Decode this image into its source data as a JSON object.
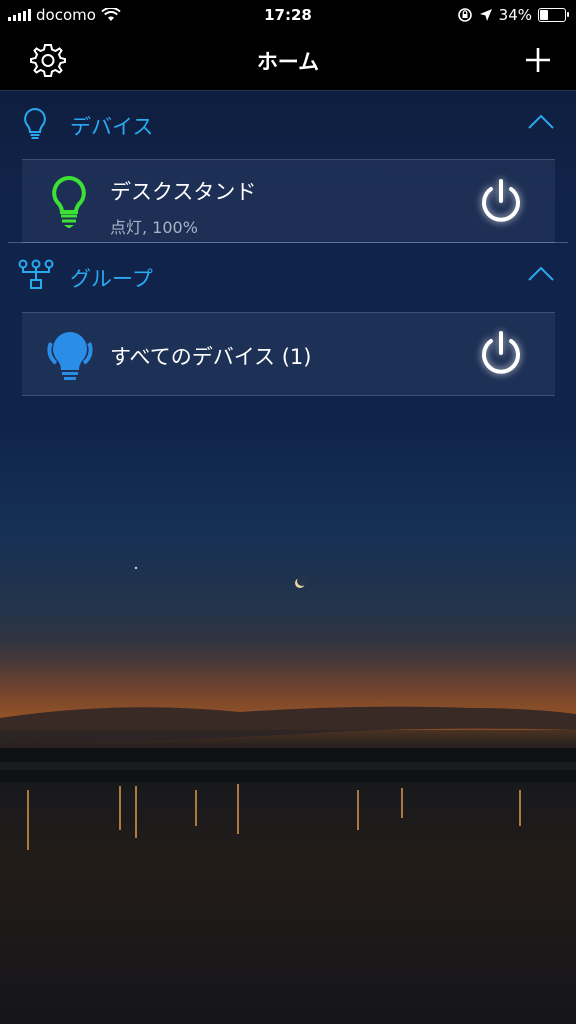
{
  "status_bar": {
    "carrier": "docomo",
    "time": "17:28",
    "battery_percent": "34%"
  },
  "nav": {
    "title": "ホーム",
    "settings_icon": "gear-icon",
    "add_icon": "plus-icon"
  },
  "sections": {
    "devices": {
      "label": "デバイス",
      "icon": "lightbulb-outline-icon",
      "items": [
        {
          "name": "デスクスタンド",
          "status": "点灯, 100%",
          "icon": "lightbulb-green-icon",
          "icon_color": "#3de034"
        }
      ]
    },
    "groups": {
      "label": "グループ",
      "icon": "group-tree-icon",
      "items": [
        {
          "name": "すべてのデバイス (1)",
          "icon": "lightbulb-blue-icon",
          "icon_color": "#2a8de8"
        }
      ]
    }
  },
  "colors": {
    "accent": "#2aa8f0",
    "navbar": "#000000"
  }
}
